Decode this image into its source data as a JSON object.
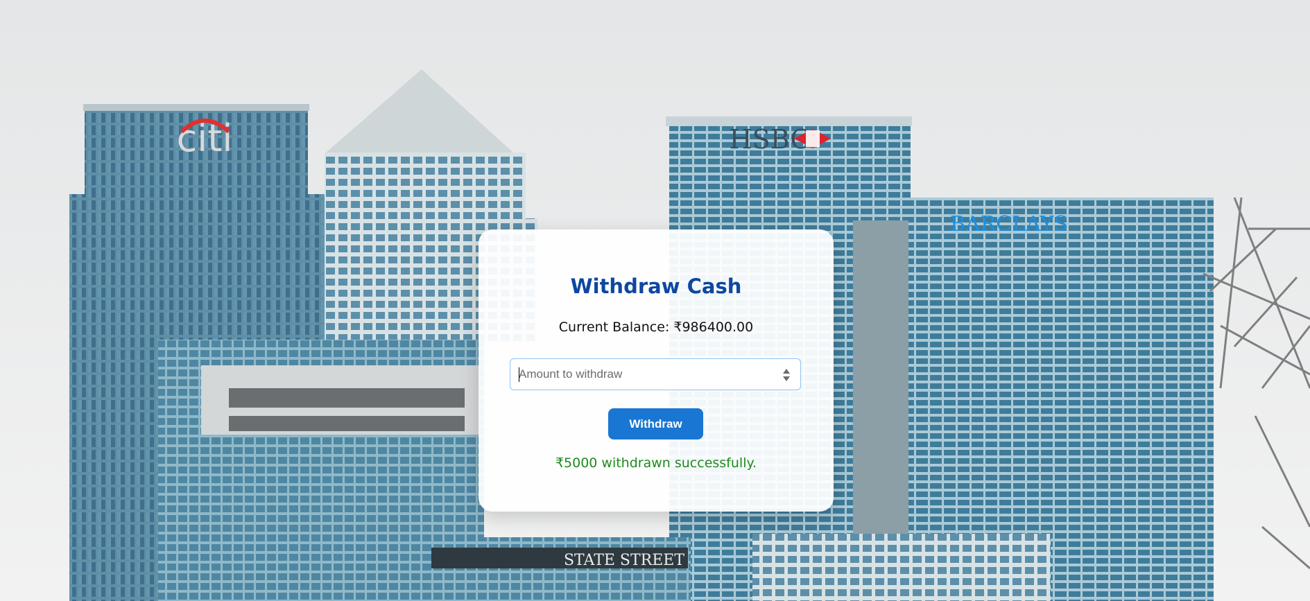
{
  "background": {
    "logos": {
      "citi": "citi",
      "hsbc": "HSBC",
      "barclays": "BARCLAYS",
      "statestreet": "STATE STREET"
    }
  },
  "withdraw": {
    "title": "Withdraw Cash",
    "balance_label": "Current Balance: ₹986400.00",
    "amount_placeholder": "Amount to withdraw",
    "amount_value": "",
    "button_label": "Withdraw",
    "status_message": "₹5000 withdrawn successfully."
  },
  "colors": {
    "title": "#0d47a1",
    "button": "#1976d2",
    "success": "#1e8a1e"
  }
}
